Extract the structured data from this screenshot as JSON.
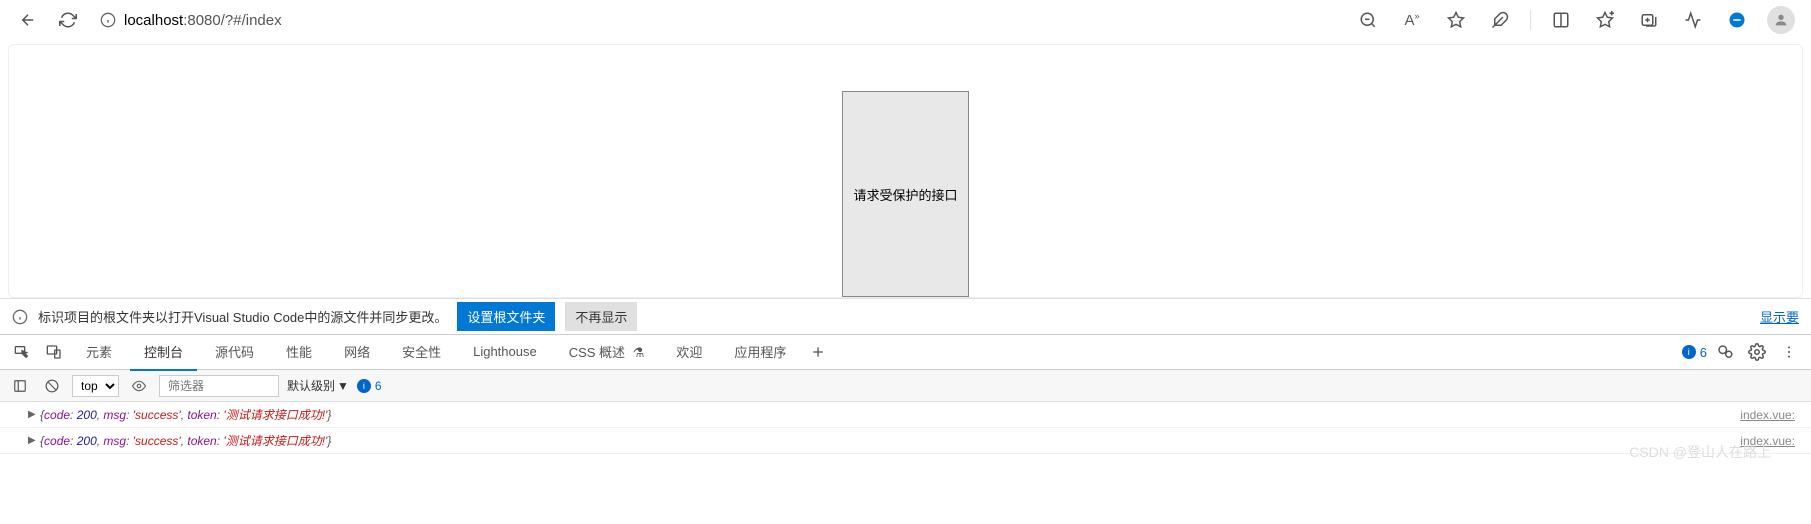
{
  "browser": {
    "url_prefix": "localhost",
    "url_suffix": ":8080/?#/index"
  },
  "page": {
    "button_label": "请求受保护的接口"
  },
  "info_bar": {
    "message": "标识项目的根文件夹以打开Visual Studio Code中的源文件并同步更改。",
    "set_root_btn": "设置根文件夹",
    "dismiss_btn": "不再显示",
    "show_link": "显示要"
  },
  "devtools": {
    "tabs": {
      "elements": "元素",
      "console": "控制台",
      "sources": "源代码",
      "performance": "性能",
      "network": "网络",
      "security": "安全性",
      "lighthouse": "Lighthouse",
      "css_overview": "CSS 概述",
      "welcome": "欢迎",
      "application": "应用程序"
    },
    "issues_count": "6"
  },
  "console_toolbar": {
    "context": "top",
    "filter_placeholder": "筛选器",
    "level": "默认级别",
    "issues_count": "6"
  },
  "console": {
    "lines": [
      {
        "code": "200",
        "msg": "'success'",
        "token": "'测试请求接口成功!'",
        "src": "index.vue:"
      },
      {
        "code": "200",
        "msg": "'success'",
        "token": "'测试请求接口成功!'",
        "src": "index.vue:"
      }
    ]
  },
  "watermark": "CSDN @登山人在路上"
}
